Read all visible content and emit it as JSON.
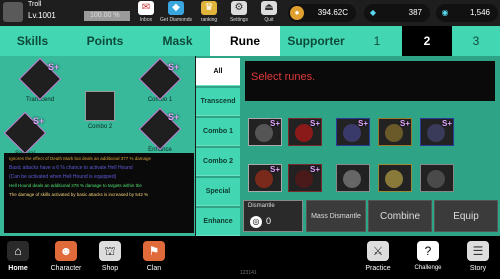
{
  "profile": {
    "name": "Troll",
    "level": "Lv.1001",
    "percent": "100.00 %",
    "progress": 1.0
  },
  "top_buttons": [
    {
      "label": "Inbox",
      "icon": "mail-icon",
      "badge": "2"
    },
    {
      "label": "Get Diamonds",
      "icon": "diamond-shop-icon"
    },
    {
      "label": "ranking",
      "icon": "trophy-icon"
    },
    {
      "label": "Settings",
      "icon": "gear-icon"
    },
    {
      "label": "Quit",
      "icon": "exit-icon"
    }
  ],
  "resources": {
    "gold": "394.62C",
    "diamonds": "387",
    "tickets": "1,546"
  },
  "tabs": [
    "Skills",
    "Points",
    "Mask",
    "Rune",
    "Supporter",
    "1",
    "2",
    "3"
  ],
  "active_tab": "Rune",
  "active_page": "2",
  "skills": [
    {
      "label": "Transcend",
      "grade": "S+"
    },
    {
      "label": "Combo 1",
      "grade": "S+"
    },
    {
      "label": "Combo 2",
      "grade": ""
    },
    {
      "label": "Special",
      "grade": "S+"
    },
    {
      "label": "Enhance",
      "grade": "S+"
    }
  ],
  "descriptions": [
    "Ignores the effect of Death Mark but deals an additional 377 % damage",
    "Basic attacks have a 6 % chance to activate Hell Hound",
    "(Can be activated when Hell Hound is equipped)",
    "Hell Hound deals an additional 378 % damage to targets within the",
    "The damage of skills activated by basic attacks is increased by 542 %"
  ],
  "rune_tabs": [
    "All",
    "Transcend",
    "Combo 1",
    "Combo 2",
    "Special",
    "Enhance"
  ],
  "active_rune_tab": "All",
  "select_text": "Select runes.",
  "runes_row1": [
    "S+",
    "S+",
    "S+",
    "S+",
    "S+"
  ],
  "runes_row2": [
    "S+",
    "S+",
    "",
    "",
    ""
  ],
  "dismantle": {
    "label": "Dismantle",
    "count": "0"
  },
  "actions": {
    "mass_dismantle": "Mass Dismantle",
    "combine": "Combine",
    "equip": "Equip"
  },
  "nav": [
    {
      "label": "Home",
      "icon": "home-icon"
    },
    {
      "label": "Character",
      "icon": "character-icon"
    },
    {
      "label": "Shop",
      "icon": "shop-icon"
    },
    {
      "label": "Clan",
      "icon": "clan-icon"
    },
    {
      "label": "Practice",
      "icon": "practice-icon"
    },
    {
      "label": "Challenge",
      "icon": "challenge-icon"
    },
    {
      "label": "Story",
      "icon": "story-icon"
    }
  ],
  "footer_text": "123141",
  "colors": {
    "teal": "#43d6b3",
    "dark": "#0a0a0a",
    "rune_grade": "#e2a6ff",
    "select": "#e0393a"
  }
}
